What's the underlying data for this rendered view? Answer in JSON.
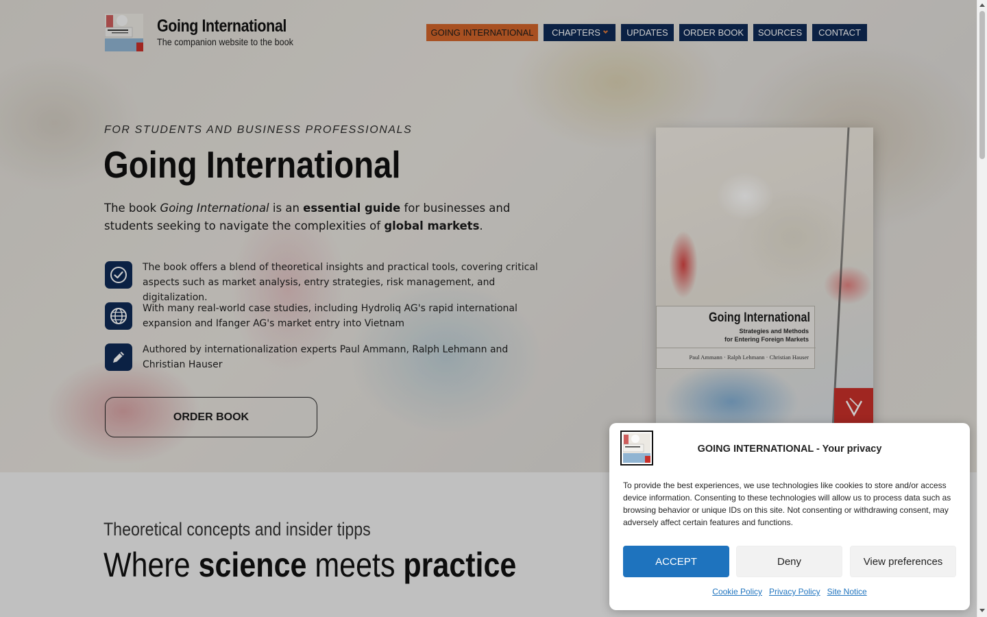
{
  "header": {
    "brand_title": "Going International",
    "brand_subtitle": "The companion website to the book",
    "nav": [
      {
        "label": "GOING INTERNATIONAL",
        "active": true
      },
      {
        "label": "CHAPTERS",
        "dropdown": true
      },
      {
        "label": "UPDATES"
      },
      {
        "label": "ORDER BOOK"
      },
      {
        "label": "SOURCES"
      },
      {
        "label": "CONTACT"
      }
    ]
  },
  "hero": {
    "eyebrow": "FOR STUDENTS AND BUSINESS PROFESSIONALS",
    "title": "Going International",
    "intro": {
      "p1": "The book ",
      "p2": "Going International",
      "p3": " is an ",
      "p4": "essential guide",
      "p5": " for businesses and students seeking to navigate the complexities of ",
      "p6": "global markets",
      "p7": "."
    },
    "features": [
      {
        "icon": "check-circle-icon",
        "text": "The book offers a blend of theoretical insights and practical tools, covering critical aspects such as market analysis, entry strategies, risk management, and digitalization."
      },
      {
        "icon": "globe-icon",
        "text": "With many real-world case studies, including Hydroliq AG's rapid international expansion and Ifanger AG's market entry into Vietnam"
      },
      {
        "icon": "pencil-icon",
        "text": "Authored by internationalization experts Paul Ammann, Ralph Lehmann and Christian Hauser"
      }
    ],
    "order_button": "ORDER BOOK",
    "book_cover": {
      "title": "Going International",
      "subtitle_line1": "Strategies and Methods",
      "subtitle_line2": "for Entering Foreign Markets",
      "authors": "Paul Ammann · Ralph Lehmann · Christian Hauser"
    }
  },
  "section": {
    "eyebrow": "Theoretical concepts and insider tipps",
    "title_w1": "Where ",
    "title_w2": "science",
    "title_w3": " meets ",
    "title_w4": "practice"
  },
  "cookie": {
    "title": "GOING INTERNATIONAL - Your privacy",
    "text": "To provide the best experiences, we use technologies like cookies to store and/or access device information. Consenting to these technologies will allow us to process data such as browsing behavior or unique IDs on this site. Not consenting or withdrawing consent, may adversely affect certain features and functions.",
    "accept": "ACCEPT",
    "deny": "Deny",
    "preferences": "View preferences",
    "links": [
      "Cookie Policy",
      "Privacy Policy",
      "Site Notice"
    ]
  },
  "colors": {
    "nav_bg": "#0e2a56",
    "nav_active": "#d2652a",
    "accept_blue": "#1e73be"
  }
}
